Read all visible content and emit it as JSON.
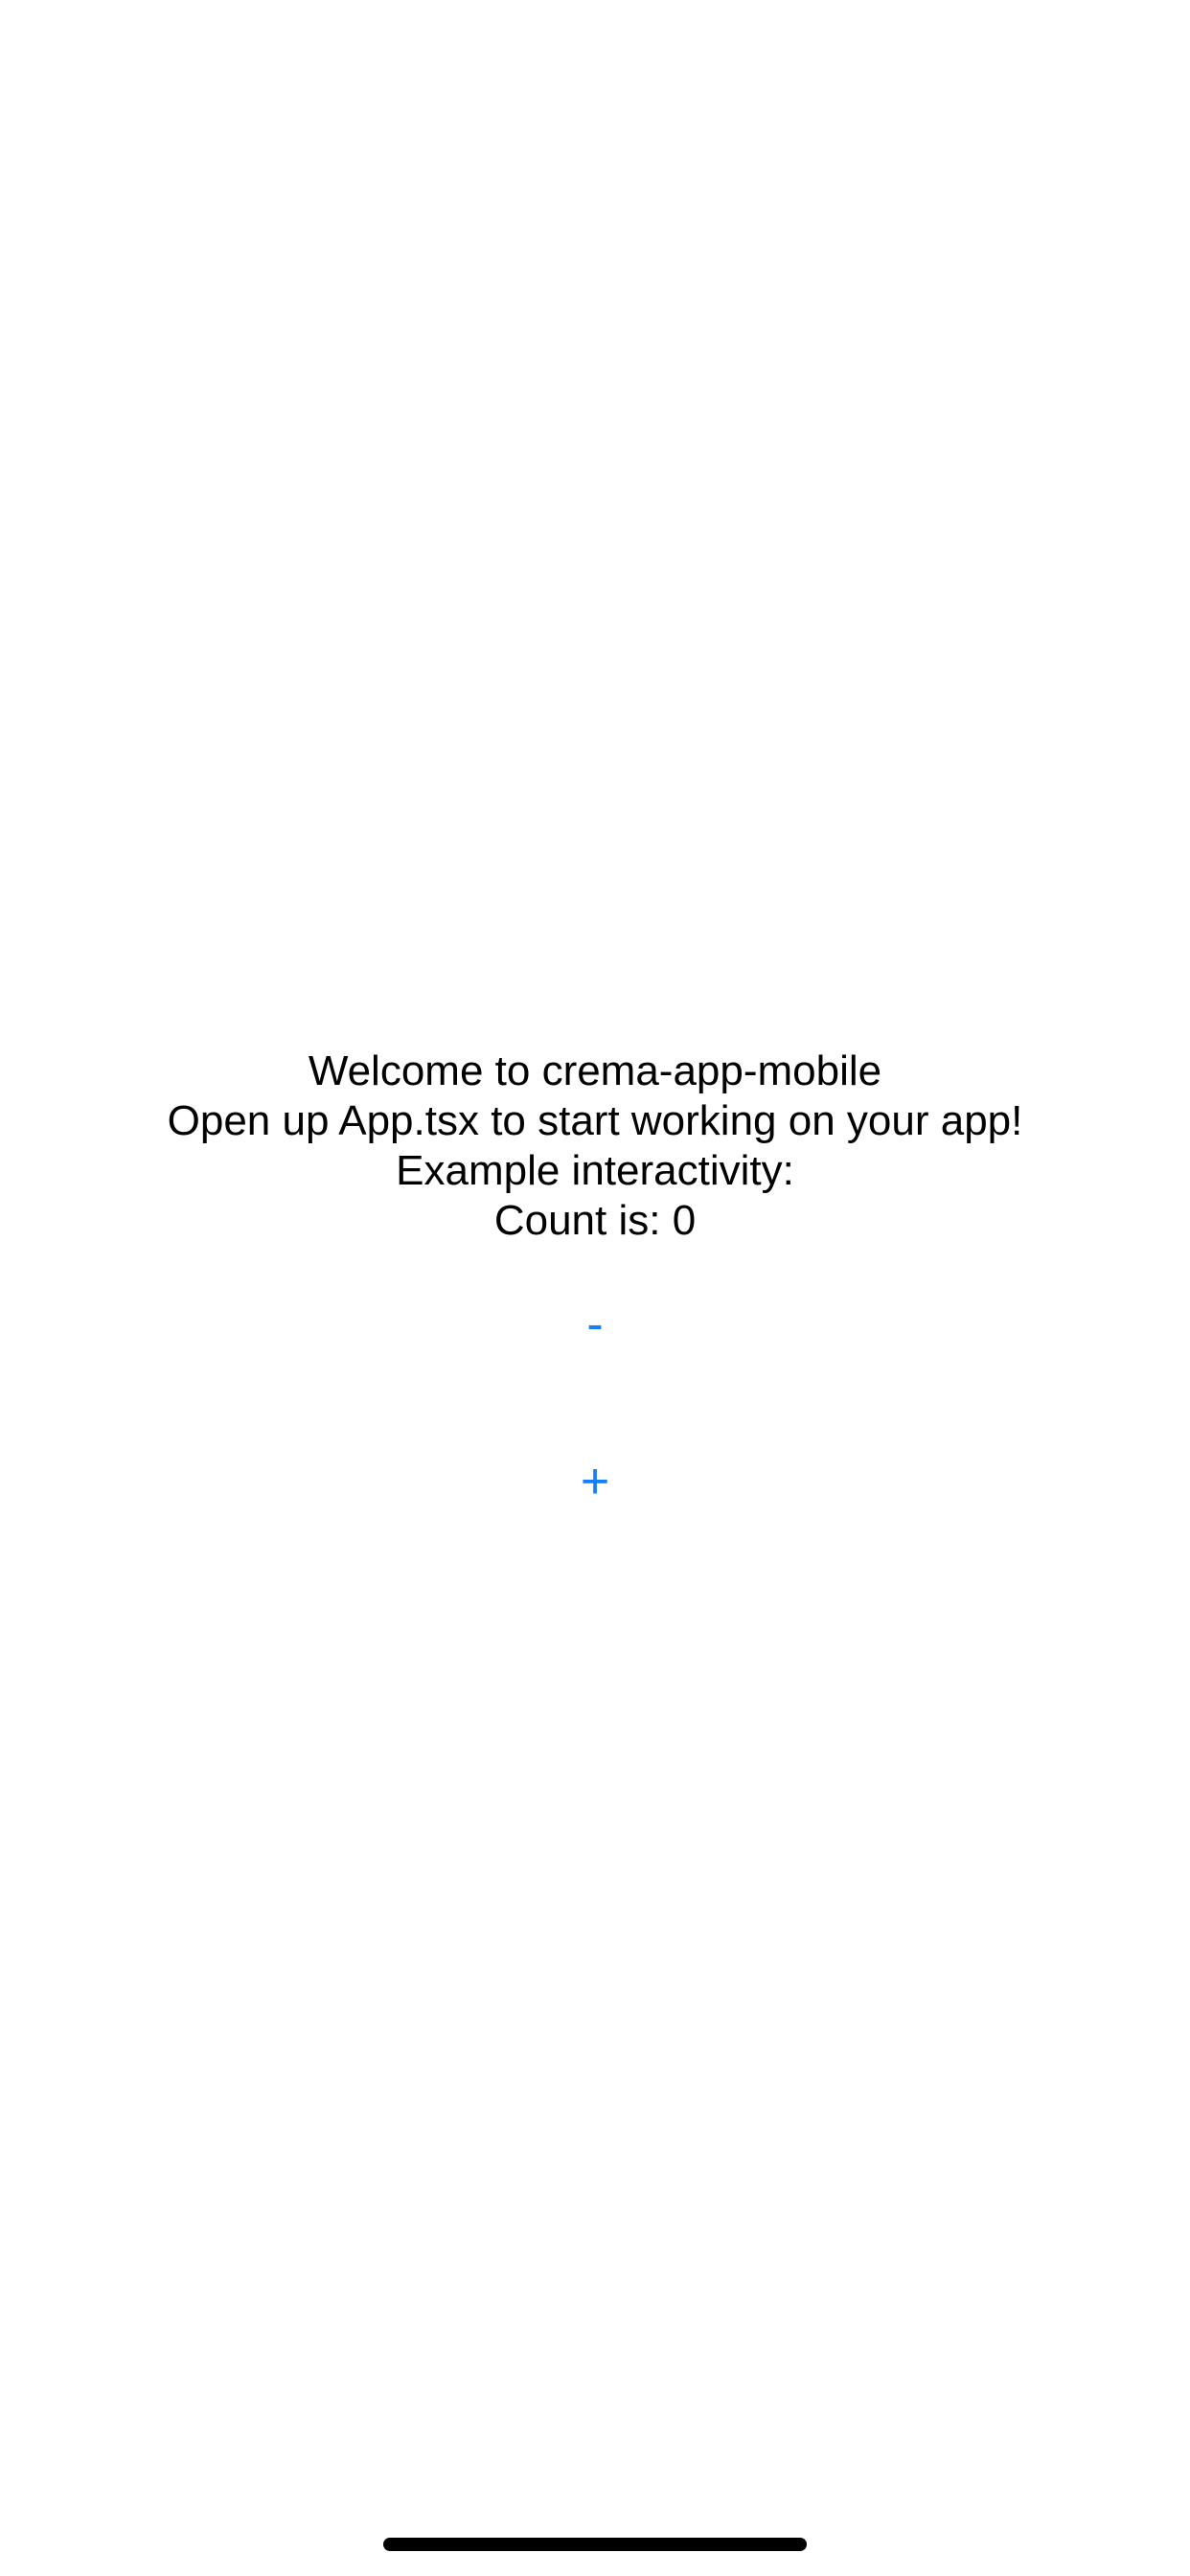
{
  "app": {
    "welcome_text": "Welcome to crema-app-mobile",
    "instruction_text": "Open up App.tsx to start working on your app!",
    "example_label": "Example interactivity:",
    "count_text": "Count is: 0",
    "count_value": 0
  },
  "controls": {
    "decrement_label": "-",
    "increment_label": "+"
  },
  "colors": {
    "background": "#ffffff",
    "text": "#000000",
    "button_text": "#147efb",
    "home_indicator": "#000000"
  }
}
